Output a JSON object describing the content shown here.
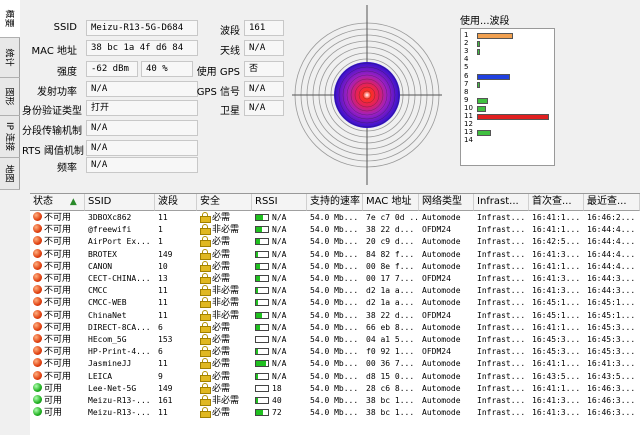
{
  "tabs": [
    "概要",
    "统计",
    "图形",
    "IP 连接",
    "地图"
  ],
  "details": {
    "ssid_label": "SSID",
    "ssid": "Meizu-R13-5G-D684",
    "mac_label": "MAC 地址",
    "mac": "38 bc 1a 4f d6 84",
    "strength_label": "强度",
    "strength_dbm": "-62 dBm",
    "strength_pct": "40 %",
    "txpower_label": "发射功率",
    "txpower": "N/A",
    "auth_label": "身份验证类型",
    "auth": "打开",
    "frag_label": "分段传输机制",
    "frag": "N/A",
    "rts_label": "RTS 阈值机制",
    "rts": "N/A",
    "freq_label": "频率",
    "freq": "N/A",
    "channel_label": "波段",
    "channel": "161",
    "antenna_label": "天线",
    "antenna": "N/A",
    "gps_label": "使用 GPS",
    "gps": "否",
    "gps_signal_label": "GPS 信号",
    "gps_signal": "N/A",
    "satellite_label": "卫星",
    "satellite": "N/A"
  },
  "usage": {
    "title": "使用...波段",
    "channels": [
      {
        "ch": "1",
        "value": 5,
        "color": "#f0a050"
      },
      {
        "ch": "2",
        "value": 0.4,
        "color": "#40c040"
      },
      {
        "ch": "3",
        "value": 0.4,
        "color": "#40c040"
      },
      {
        "ch": "4",
        "value": 0,
        "color": "#40c040"
      },
      {
        "ch": "5",
        "value": 0,
        "color": "#40c040"
      },
      {
        "ch": "6",
        "value": 4.5,
        "color": "#2040e0"
      },
      {
        "ch": "7",
        "value": 0.4,
        "color": "#40c040"
      },
      {
        "ch": "8",
        "value": 0,
        "color": "#40c040"
      },
      {
        "ch": "9",
        "value": 1.5,
        "color": "#40c040"
      },
      {
        "ch": "10",
        "value": 1.3,
        "color": "#40c040"
      },
      {
        "ch": "11",
        "value": 10,
        "color": "#e02020"
      },
      {
        "ch": "12",
        "value": 0,
        "color": "#40c040"
      },
      {
        "ch": "13",
        "value": 2,
        "color": "#40c040"
      },
      {
        "ch": "14",
        "value": 0,
        "color": "#40c040"
      }
    ],
    "max": 10.5
  },
  "table": {
    "headers": [
      "状态",
      "SSID",
      "波段",
      "安全",
      "RSSI",
      "支持的速率",
      "MAC 地址",
      "网络类型",
      "Infrast...",
      "首次查...",
      "最近查..."
    ],
    "rows": [
      {
        "state": "不可用",
        "ok": false,
        "ssid": "3DBOXc862",
        "ch": "11",
        "sec": "必需",
        "rssi": "N/A",
        "rssi_fill": 0.6,
        "rate": "54.0 Mb...",
        "mac": "7e c7 0d ...",
        "type": "Automode",
        "infra": "Infrast...",
        "first": "16:41:1...",
        "last": "16:46:2..."
      },
      {
        "state": "不可用",
        "ok": false,
        "ssid": "@freewifi",
        "ch": "1",
        "sec": "非必需",
        "rssi": "N/A",
        "rssi_fill": 0.5,
        "rate": "54.0 Mb...",
        "mac": "38 22 d...",
        "type": "OFDM24",
        "infra": "Infrast...",
        "first": "16:41:1...",
        "last": "16:44:4..."
      },
      {
        "state": "不可用",
        "ok": false,
        "ssid": "AirPort Ex...",
        "ch": "1",
        "sec": "必需",
        "rssi": "N/A",
        "rssi_fill": 0.3,
        "rate": "54.0 Mb...",
        "mac": "20 c9 d...",
        "type": "Automode",
        "infra": "Infrast...",
        "first": "16:42:5...",
        "last": "16:44:4..."
      },
      {
        "state": "不可用",
        "ok": false,
        "ssid": "BROTEX",
        "ch": "149",
        "sec": "必需",
        "rssi": "N/A",
        "rssi_fill": 0.2,
        "rate": "54.0 Mb...",
        "mac": "84 82 f...",
        "type": "Automode",
        "infra": "Infrast...",
        "first": "16:41:3...",
        "last": "16:44:4..."
      },
      {
        "state": "不可用",
        "ok": false,
        "ssid": "CANON",
        "ch": "10",
        "sec": "必需",
        "rssi": "N/A",
        "rssi_fill": 0.3,
        "rate": "54.0 Mb...",
        "mac": "00 8e f...",
        "type": "Automode",
        "infra": "Infrast...",
        "first": "16:41:1...",
        "last": "16:44:4..."
      },
      {
        "state": "不可用",
        "ok": false,
        "ssid": "CECT-CHINA...",
        "ch": "13",
        "sec": "必需",
        "rssi": "N/A",
        "rssi_fill": 0.3,
        "rate": "54.0 Mb...",
        "mac": "00 17 7...",
        "type": "OFDM24",
        "infra": "Infrast...",
        "first": "16:41:3...",
        "last": "16:44:3..."
      },
      {
        "state": "不可用",
        "ok": false,
        "ssid": "CMCC",
        "ch": "11",
        "sec": "非必需",
        "rssi": "N/A",
        "rssi_fill": 0.2,
        "rate": "54.0 Mb...",
        "mac": "d2 1a a...",
        "type": "Automode",
        "infra": "Infrast...",
        "first": "16:41:3...",
        "last": "16:44:3..."
      },
      {
        "state": "不可用",
        "ok": false,
        "ssid": "CMCC-WEB",
        "ch": "11",
        "sec": "非必需",
        "rssi": "N/A",
        "rssi_fill": 0.2,
        "rate": "54.0 Mb...",
        "mac": "d2 1a a...",
        "type": "Automode",
        "infra": "Infrast...",
        "first": "16:45:1...",
        "last": "16:45:1..."
      },
      {
        "state": "不可用",
        "ok": false,
        "ssid": "ChinaNet",
        "ch": "11",
        "sec": "非必需",
        "rssi": "N/A",
        "rssi_fill": 0.5,
        "rate": "54.0 Mb...",
        "mac": "38 22 d...",
        "type": "OFDM24",
        "infra": "Infrast...",
        "first": "16:45:1...",
        "last": "16:45:1..."
      },
      {
        "state": "不可用",
        "ok": false,
        "ssid": "DIRECT-8CA...",
        "ch": "6",
        "sec": "必需",
        "rssi": "N/A",
        "rssi_fill": 0.3,
        "rate": "54.0 Mb...",
        "mac": "66 eb 8...",
        "type": "Automode",
        "infra": "Infrast...",
        "first": "16:41:1...",
        "last": "16:45:3..."
      },
      {
        "state": "不可用",
        "ok": false,
        "ssid": "HEcom_5G",
        "ch": "153",
        "sec": "必需",
        "rssi": "N/A",
        "rssi_fill": 0,
        "rate": "54.0 Mb...",
        "mac": "04 a1 5...",
        "type": "Automode",
        "infra": "Infrast...",
        "first": "16:45:3...",
        "last": "16:45:3..."
      },
      {
        "state": "不可用",
        "ok": false,
        "ssid": "HP-Print-4...",
        "ch": "6",
        "sec": "必需",
        "rssi": "N/A",
        "rssi_fill": 0.2,
        "rate": "54.0 Mb...",
        "mac": "f0 92 1...",
        "type": "OFDM24",
        "infra": "Infrast...",
        "first": "16:45:3...",
        "last": "16:45:3..."
      },
      {
        "state": "不可用",
        "ok": false,
        "ssid": "JasmineJJ",
        "ch": "11",
        "sec": "必需",
        "rssi": "N/A",
        "rssi_fill": 0.8,
        "rate": "54.0 Mb...",
        "mac": "00 36 7...",
        "type": "Automode",
        "infra": "Infrast...",
        "first": "16:41:1...",
        "last": "16:41:3..."
      },
      {
        "state": "不可用",
        "ok": false,
        "ssid": "LEICA",
        "ch": "9",
        "sec": "必需",
        "rssi": "N/A",
        "rssi_fill": 0.2,
        "rate": "54.0 Mb...",
        "mac": "d8 15 0...",
        "type": "Automode",
        "infra": "Infrast...",
        "first": "16:43:5...",
        "last": "16:43:5..."
      },
      {
        "state": "可用",
        "ok": true,
        "ssid": "Lee-Net-5G",
        "ch": "149",
        "sec": "必需",
        "rssi": "18",
        "rssi_fill": 0,
        "rate": "54.0 Mb...",
        "mac": "28 c6 8...",
        "type": "Automode",
        "infra": "Infrast...",
        "first": "16:41:1...",
        "last": "16:46:3..."
      },
      {
        "state": "可用",
        "ok": true,
        "ssid": "Meizu-R13-...",
        "ch": "161",
        "sec": "非必需",
        "rssi": "40",
        "rssi_fill": 0.2,
        "rate": "54.0 Mb...",
        "mac": "38 bc 1...",
        "type": "Automode",
        "infra": "Infrast...",
        "first": "16:41:3...",
        "last": "16:46:3..."
      },
      {
        "state": "可用",
        "ok": true,
        "ssid": "Meizu-R13-...",
        "ch": "11",
        "sec": "必需",
        "rssi": "72",
        "rssi_fill": 0.6,
        "rate": "54.0 Mb...",
        "mac": "38 bc 1...",
        "type": "Automode",
        "infra": "Infrast...",
        "first": "16:41:3...",
        "last": "16:46:3..."
      }
    ]
  }
}
